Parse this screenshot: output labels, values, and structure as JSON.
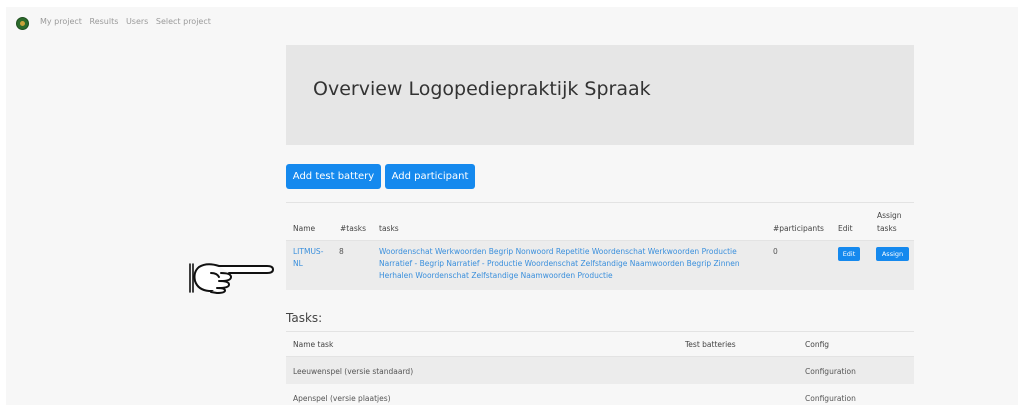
{
  "nav": {
    "items": [
      "My project",
      "Results",
      "Users",
      "Select project"
    ]
  },
  "header": {
    "title": "Overview Logopediepraktijk Spraak"
  },
  "actions": {
    "add_test_battery": "Add test battery",
    "add_participant": "Add participant"
  },
  "battery_table": {
    "headers": {
      "name": "Name",
      "ntasks": "#tasks",
      "tasks": "tasks",
      "nparticipants": "#participants",
      "edit": "Edit",
      "assign_line1": "Assign",
      "assign_line2": "tasks"
    },
    "rows": [
      {
        "name_line1": "LITMUS-",
        "name_line2": "NL",
        "ntasks": "8",
        "tasks_line1": "Woordenschat Werkwoorden Begrip Nonwoord Repetitie Woordenschat Werkwoorden Productie",
        "tasks_line2": "Narratief - Begrip Narratief - Productie Woordenschat Zelfstandige Naamwoorden Begrip Zinnen",
        "tasks_line3": "Herhalen Woordenschat Zelfstandige Naamwoorden Productie",
        "nparticipants": "0",
        "edit": "Edit",
        "assign": "Assign"
      }
    ]
  },
  "tasks_section": {
    "title": "Tasks:",
    "headers": {
      "name": "Name task",
      "batteries": "Test batteries",
      "config": "Config"
    },
    "rows": [
      {
        "name": "Leeuwenspel (versie standaard)",
        "config": "Configuration"
      },
      {
        "name": "Apenspel (versie plaatjes)",
        "config": "Configuration"
      }
    ]
  },
  "colors": {
    "primary": "#1589ee",
    "link": "#3a8fdc",
    "background": "#f7f7f7",
    "jumbotron": "#e6e6e6"
  },
  "annotation": {
    "icon": "pointing-hand-icon"
  }
}
